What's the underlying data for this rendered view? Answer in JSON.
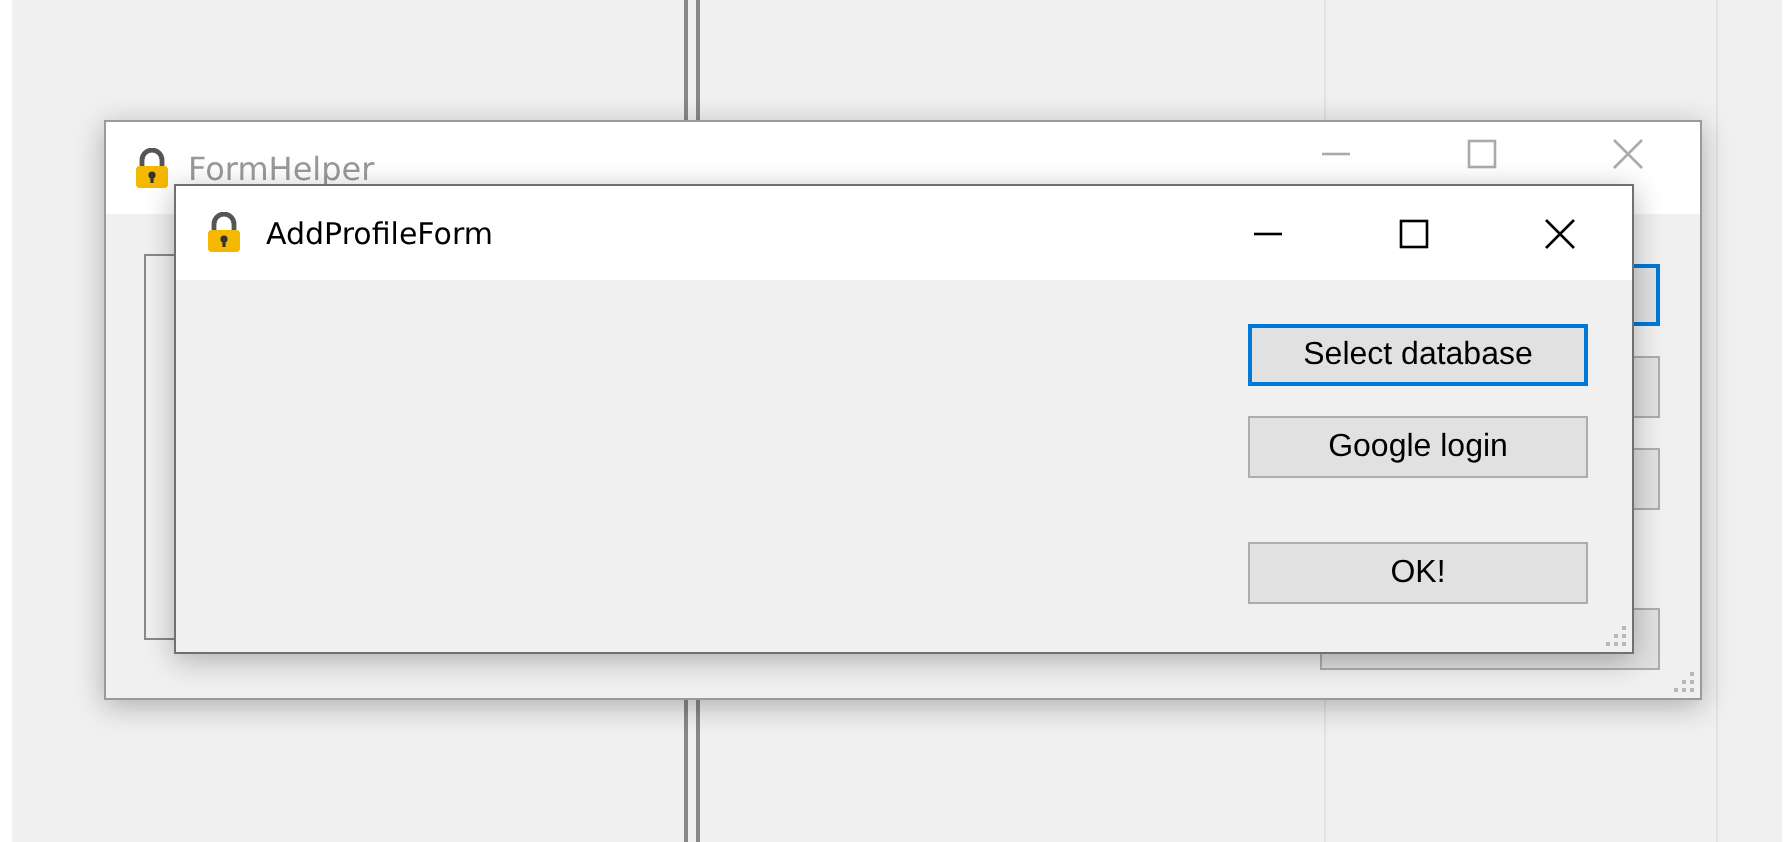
{
  "windows": [
    {
      "title": "FormHelper",
      "active": false,
      "buttons": [
        {
          "default": true
        },
        {
          "default": false
        },
        {
          "default": false
        },
        {
          "default": false
        }
      ]
    },
    {
      "title": "AddProfileForm",
      "active": true,
      "buttons": [
        {
          "label": "Select database",
          "default": true
        },
        {
          "label": "Google login",
          "default": false
        },
        {
          "label": "OK!",
          "default": false
        }
      ]
    }
  ]
}
